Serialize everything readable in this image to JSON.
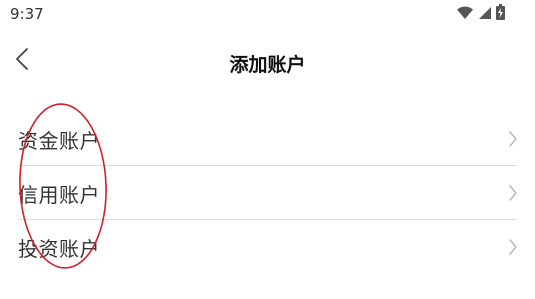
{
  "status_bar": {
    "time": "9:37",
    "icons": [
      "wifi-icon",
      "signal-icon",
      "battery-charging-icon"
    ]
  },
  "header": {
    "title": "添加账户",
    "back_icon": "chevron-left-icon"
  },
  "accounts": {
    "items": [
      {
        "label": "资金账户"
      },
      {
        "label": "信用账户"
      },
      {
        "label": "投资账户"
      }
    ]
  },
  "colors": {
    "annotation_red": "#d0202a",
    "divider": "#dddddd",
    "chevron": "#aaaaaa"
  }
}
